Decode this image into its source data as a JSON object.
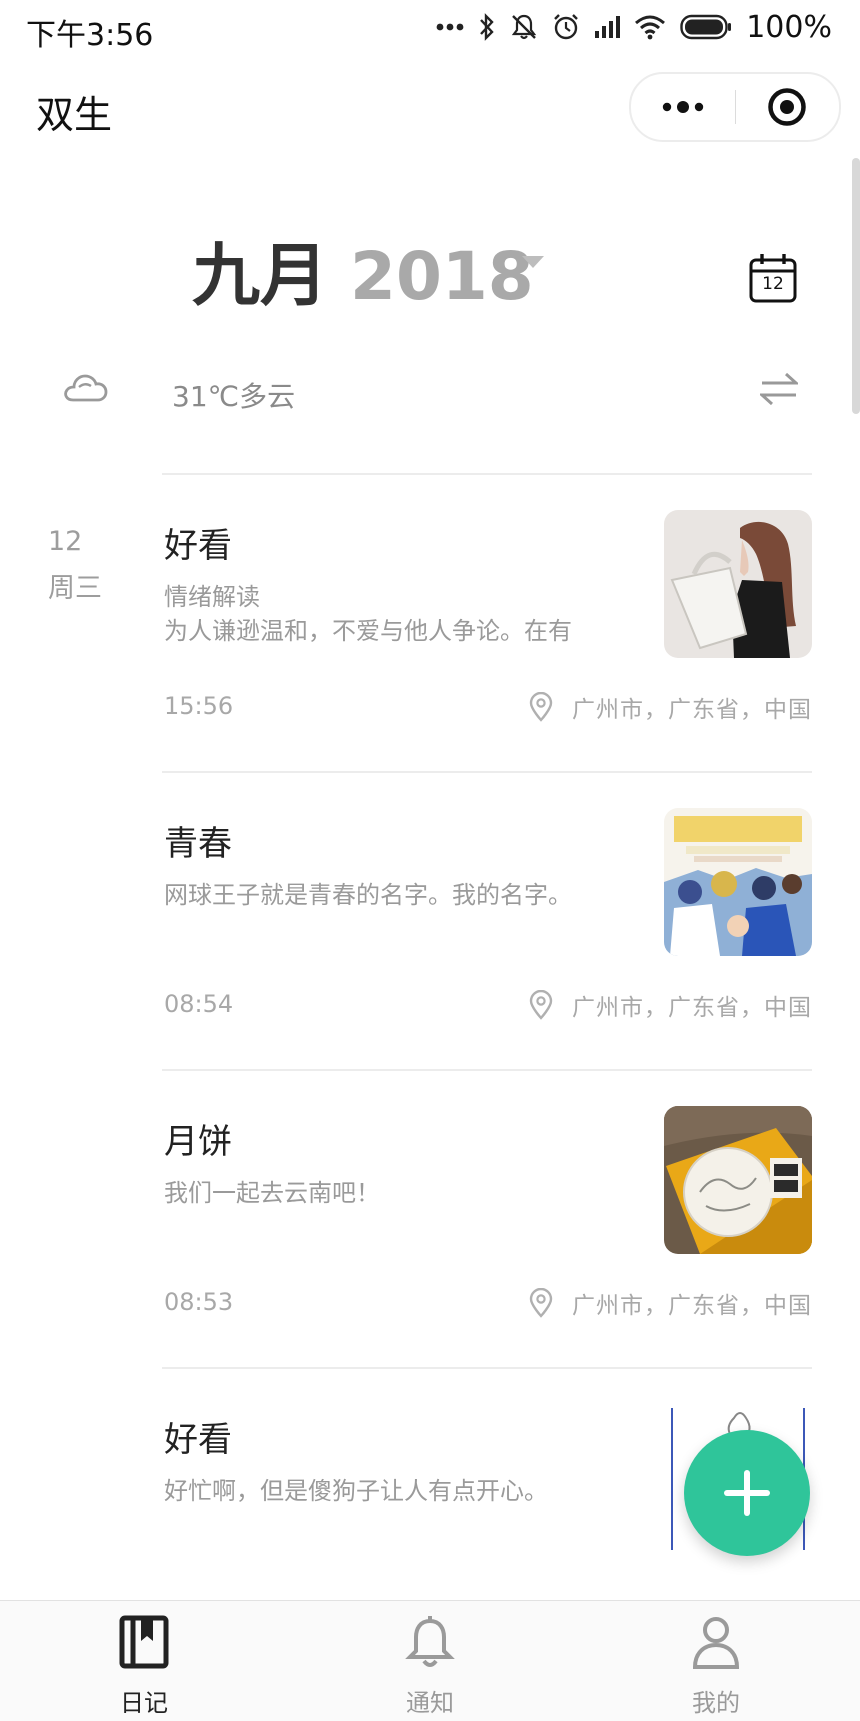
{
  "status_bar": {
    "time": "下午3:56",
    "battery": "100%"
  },
  "header": {
    "title": "双生"
  },
  "month": {
    "name": "九月",
    "year": "2018",
    "calendar_day": "12"
  },
  "weather": {
    "text": "31℃多云",
    "icon": "cloud-icon"
  },
  "date": {
    "day": "12",
    "weekday": "周三"
  },
  "entries": [
    {
      "title": "好看",
      "desc1": "情绪解读",
      "desc2": "为人谦逊温和，不爱与他人争论。在有",
      "time": "15:56",
      "location": "广州市，广东省，中国"
    },
    {
      "title": "青春",
      "desc1": "网球王子就是青春的名字。我的名字。",
      "desc2": "",
      "time": "08:54",
      "location": "广州市，广东省，中国"
    },
    {
      "title": "月饼",
      "desc1": "我们一起去云南吧！",
      "desc2": "",
      "time": "08:53",
      "location": "广州市，广东省，中国"
    },
    {
      "title": "好看",
      "desc1": "好忙啊，但是傻狗子让人有点开心。",
      "desc2": ""
    }
  ],
  "tabs": [
    {
      "label": "日记",
      "icon": "diary-icon",
      "active": true
    },
    {
      "label": "通知",
      "icon": "bell-icon",
      "active": false
    },
    {
      "label": "我的",
      "icon": "person-icon",
      "active": false
    }
  ],
  "colors": {
    "accent": "#2fc59a",
    "tab_active": "#222222",
    "tab_inactive": "#9a9a9a"
  }
}
